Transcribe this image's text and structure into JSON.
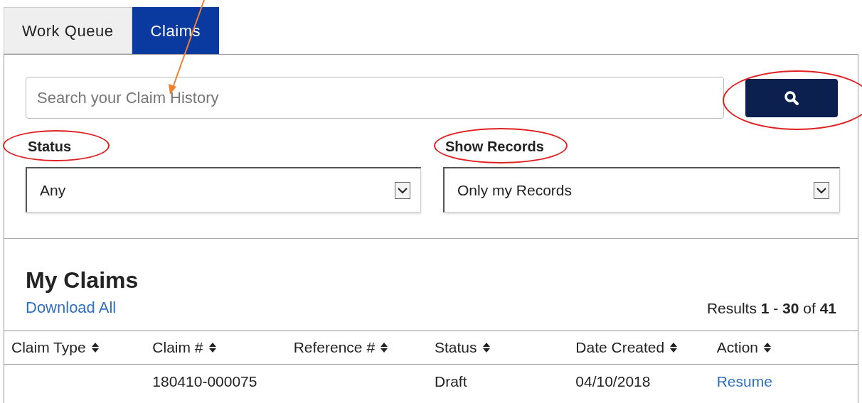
{
  "tabs": [
    {
      "label": "Work Queue",
      "selected": false
    },
    {
      "label": "Claims",
      "selected": true
    }
  ],
  "search": {
    "placeholder": "Search your Claim History"
  },
  "filters": [
    {
      "label": "Status",
      "value": "Any"
    },
    {
      "label": "Show Records",
      "value": "Only my Records"
    }
  ],
  "section": {
    "title": "My Claims",
    "download_link": "Download All",
    "results": "Results **1** - **30** of **41**"
  },
  "table": {
    "columns": [
      "Claim Type",
      "Claim #",
      "Reference #",
      "Status",
      "Date Created",
      "Action"
    ],
    "rows": [
      [
        "",
        "180410-000075",
        "",
        "Draft",
        "04/10/2018",
        "Resume"
      ]
    ]
  }
}
